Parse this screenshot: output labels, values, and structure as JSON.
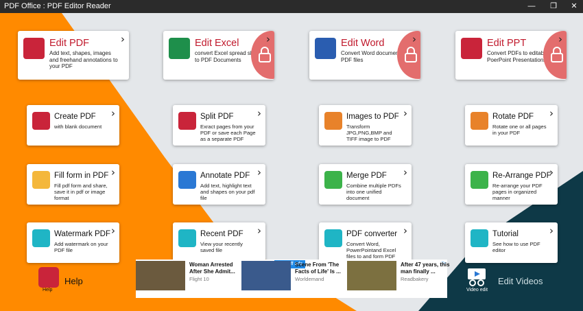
{
  "window": {
    "title": "PDF Office : PDF Editor Reader",
    "minimize": "—",
    "maximize": "❐",
    "close": "✕"
  },
  "colors": {
    "orange": "#ff8a00",
    "teal": "#0e3947",
    "grey": "#e4e7ea",
    "lock": "#e36d6d"
  },
  "top_cards": [
    {
      "title": "Edit PDF",
      "desc": "Add text, shapes, images and freehand annotations to your PDF",
      "icon": "edit-pdf-icon",
      "locked": false
    },
    {
      "title": "Edit Excel",
      "desc": "convert Excel spread sheet to PDF Documents",
      "icon": "excel-icon",
      "locked": true
    },
    {
      "title": "Edit Word",
      "desc": "Convert Word documents to PDF files",
      "icon": "word-icon",
      "locked": true
    },
    {
      "title": "Edit PPT",
      "desc": "Convert PDFs to editable PoerPoint Presentations",
      "icon": "ppt-icon",
      "locked": true
    }
  ],
  "tools": [
    {
      "title": "Create PDF",
      "desc": "with blank document",
      "icon": "create-pdf-icon"
    },
    {
      "title": "Split PDF",
      "desc": "Exract pages from your PDF or save each Page as a separate PDF",
      "icon": "split-pdf-icon"
    },
    {
      "title": "Images to PDF",
      "desc": "Transform JPG,PNG,BMP and TIFF image to PDF",
      "icon": "images-to-pdf-icon"
    },
    {
      "title": "Rotate PDF",
      "desc": "Rotate one or all pages in your PDF",
      "icon": "rotate-pdf-icon"
    },
    {
      "title": "Fill form in PDF",
      "desc": "Fill pdf form and share, save it in pdf or image format",
      "icon": "fill-form-icon"
    },
    {
      "title": "Annotate PDF",
      "desc": "Add text, highlight text and shapes on your pdf file",
      "icon": "annotate-icon"
    },
    {
      "title": "Merge PDF",
      "desc": "Combine multiple PDFs into one unified document",
      "icon": "merge-icon"
    },
    {
      "title": "Re-Arrange PDF",
      "desc": "Re-arrange your PDF pages in organized manner",
      "icon": "rearrange-icon"
    },
    {
      "title": "Watermark PDF",
      "desc": "Add watermark on your PDF file",
      "icon": "watermark-icon"
    },
    {
      "title": "Recent PDF",
      "desc": "View your recently saved file",
      "icon": "folder-icon"
    },
    {
      "title": "PDF converter",
      "desc": "Convert Word, PowerPointand Excel files to and form PDF",
      "icon": "converter-icon"
    },
    {
      "title": "Tutorial",
      "desc": "See how to use PDF editor",
      "icon": "tutorial-icon"
    }
  ],
  "ads": [
    {
      "headline": "Woman Arrested After She Admit...",
      "source": "Flight 10"
    },
    {
      "headline": "Scene From 'The Facts of Life' Is ...",
      "source": "Worldemand"
    },
    {
      "headline": "After 47 years, this man finally ...",
      "source": "Readbakery"
    }
  ],
  "ad_turn_off": "Turn off ads",
  "ad_choice": "▷",
  "help": {
    "small": "Help",
    "big": "Help"
  },
  "video": {
    "small": "Video edit",
    "big": "Edit Videos"
  }
}
